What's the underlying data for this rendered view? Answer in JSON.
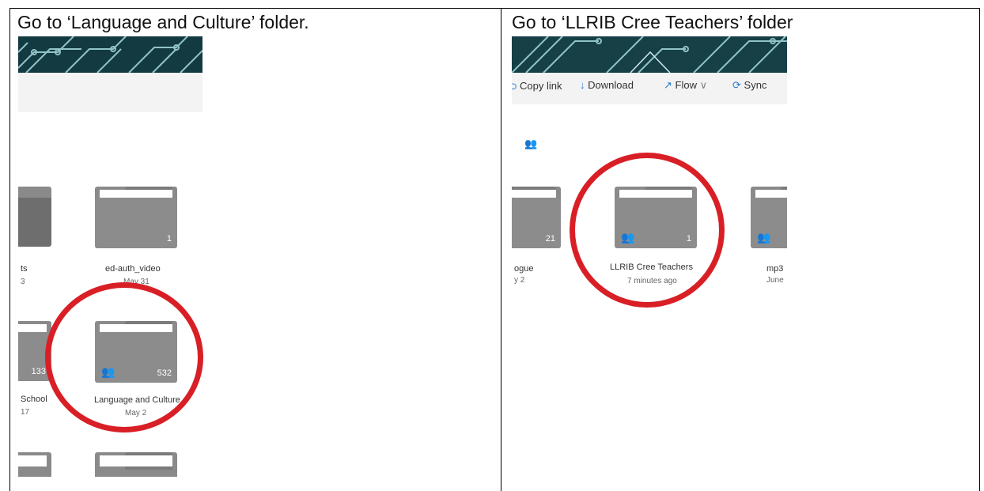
{
  "left": {
    "instruction": "Go to ‘Language and Culture’ folder.",
    "folders": [
      {
        "name": "ed-auth_video",
        "date": "May 31",
        "count": "1"
      },
      {
        "name": "Language and Culture",
        "date": "May 2",
        "count": "532"
      }
    ],
    "partial": {
      "name_a": "ts",
      "date_a": "3",
      "count_b": "133",
      "name_b": "School",
      "date_b": "17"
    }
  },
  "right": {
    "instruction": "Go to ‘LLRIB Cree Teachers’ folder",
    "commands": {
      "copy_link": "Copy link",
      "download": "Download",
      "flow": "Flow",
      "sync": "Sync"
    },
    "folders": [
      {
        "name": "LLRIB Cree Teachers",
        "date": "7 minutes ago",
        "count": "1"
      }
    ],
    "partial": {
      "count_a": "21",
      "name_a": "ogue",
      "date_a": "y 2",
      "name_c": "mp3",
      "date_c": "June"
    }
  },
  "colors": {
    "highlight_ring": "#d91f26",
    "folder_gray": "#8a8a8a",
    "banner": "#163f46",
    "accent": "#2b79d1"
  },
  "icons": [
    "copy-link-icon",
    "download-icon",
    "flow-icon",
    "sync-icon",
    "shared-people-icon",
    "folder-icon"
  ]
}
